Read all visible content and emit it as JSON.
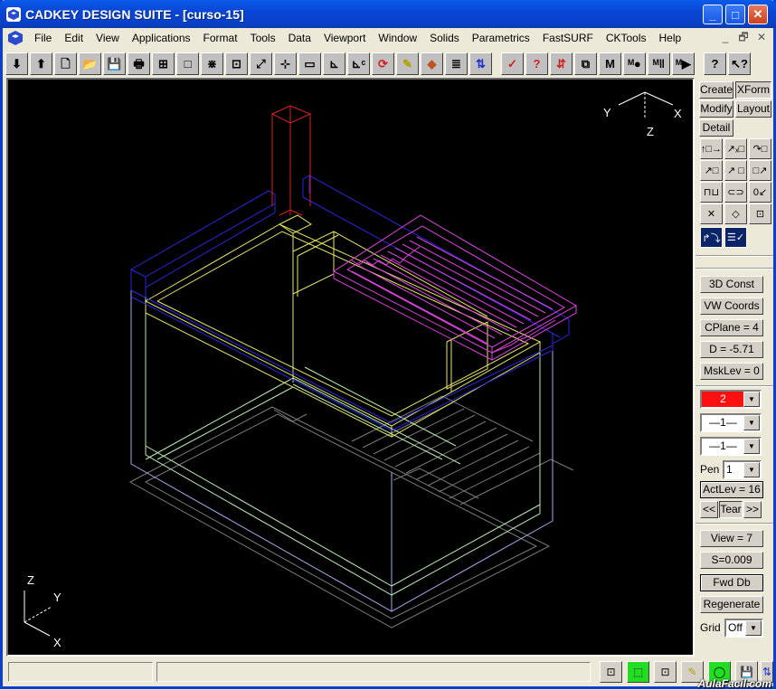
{
  "window": {
    "title": "CADKEY DESIGN SUITE - [curso-15]",
    "controls": {
      "minimize": "_",
      "maximize": "□",
      "close": "✕"
    }
  },
  "menubar": {
    "items": [
      "File",
      "Edit",
      "View",
      "Applications",
      "Format",
      "Tools",
      "Data",
      "Viewport",
      "Window",
      "Solids",
      "Parametrics",
      "FastSURF",
      "CKTools",
      "Help"
    ],
    "mdi_controls": [
      "_",
      "🗗",
      "✕"
    ]
  },
  "toolbar": {
    "buttons": [
      {
        "name": "import-down",
        "icon": "⬇"
      },
      {
        "name": "export-up",
        "icon": "⬆"
      },
      {
        "name": "new-file",
        "icon": "🗋"
      },
      {
        "name": "open-folder",
        "icon": "📂"
      },
      {
        "name": "save-disk",
        "icon": "💾"
      },
      {
        "name": "print",
        "icon": "🖶"
      },
      {
        "name": "plot-layout",
        "icon": "⊞"
      },
      {
        "name": "blank-frame",
        "icon": "□"
      },
      {
        "name": "zoom-auto",
        "icon": "⋇"
      },
      {
        "name": "zoom-window",
        "icon": "⊡"
      },
      {
        "name": "zoom-out",
        "icon": "⤢"
      },
      {
        "name": "zoom-in",
        "icon": "⊹"
      },
      {
        "name": "zoom-box",
        "icon": "▭"
      },
      {
        "name": "axis-view",
        "icon": "⊾"
      },
      {
        "name": "axis-cplane",
        "icon": "⊾ᶜ"
      },
      {
        "name": "rotate-view",
        "icon": "⟳"
      },
      {
        "name": "eraser",
        "icon": "✎"
      },
      {
        "name": "shaded-solid",
        "icon": "◆"
      },
      {
        "name": "layer-list",
        "icon": "≣"
      },
      {
        "name": "level-manager",
        "icon": "⇅"
      },
      {
        "name": "mask-check",
        "icon": "✓"
      },
      {
        "name": "mask-query",
        "icon": "?"
      },
      {
        "name": "level-sort",
        "icon": "⇵"
      },
      {
        "name": "windows-check",
        "icon": "⧉"
      },
      {
        "name": "macro-m",
        "icon": "M"
      },
      {
        "name": "macro-record",
        "icon": "ᴹ●"
      },
      {
        "name": "macro-pause",
        "icon": "ᴹ‖"
      },
      {
        "name": "macro-play",
        "icon": "ᴹ▶"
      },
      {
        "name": "help",
        "icon": "?"
      },
      {
        "name": "context-help",
        "icon": "↖?"
      }
    ]
  },
  "viewport": {
    "view_axis": {
      "x": "X",
      "y": "Y",
      "z": "Z"
    },
    "world_axis": {
      "x": "X",
      "y": "Y",
      "z": "Z"
    },
    "colors": {
      "background": "#000000",
      "red": "#e02020",
      "blue": "#2020d8",
      "yellow": "#e8e860",
      "magenta": "#e040e0",
      "green": "#b8f0b0",
      "lavender": "#b0b0f0",
      "gray": "#808080"
    }
  },
  "rightpanel": {
    "tabs": [
      "Create",
      "XForm",
      "Modify",
      "Layout",
      "Detail"
    ],
    "tools": [
      "↑□→",
      "↗ₓ□",
      "↷□",
      "↗□",
      "↗ □",
      "□↗",
      "⊓⊔",
      "⊂⊃",
      "0↙",
      "✕",
      "◇",
      "⊡"
    ],
    "bottom_tools": [
      "↱⤵",
      "☰✓"
    ],
    "buttons": {
      "const": "3D Const",
      "coords": "VW Coords",
      "cplane": "CPlane =  4",
      "depth": "D = -5.71",
      "msklev": "MskLev =  0"
    },
    "color_select": "2",
    "line_type": "—1—",
    "line_width": "—1—",
    "pen_label": "Pen",
    "pen_value": "1",
    "actlev": "ActLev = 16",
    "prev": "<<",
    "tear": "Tear",
    "next": ">>",
    "view": "View =  7",
    "scale": "S=0.009",
    "fwd_db": "Fwd Db",
    "regenerate": "Regenerate",
    "grid_label": "Grid",
    "grid_value": "Off"
  },
  "statusbar": {
    "fields": [
      "",
      ""
    ],
    "buttons": [
      "⊡",
      "⬚",
      "⊡",
      "✎",
      "◯",
      "💾",
      "⇅"
    ],
    "watermark": "AulaFacil.com"
  }
}
